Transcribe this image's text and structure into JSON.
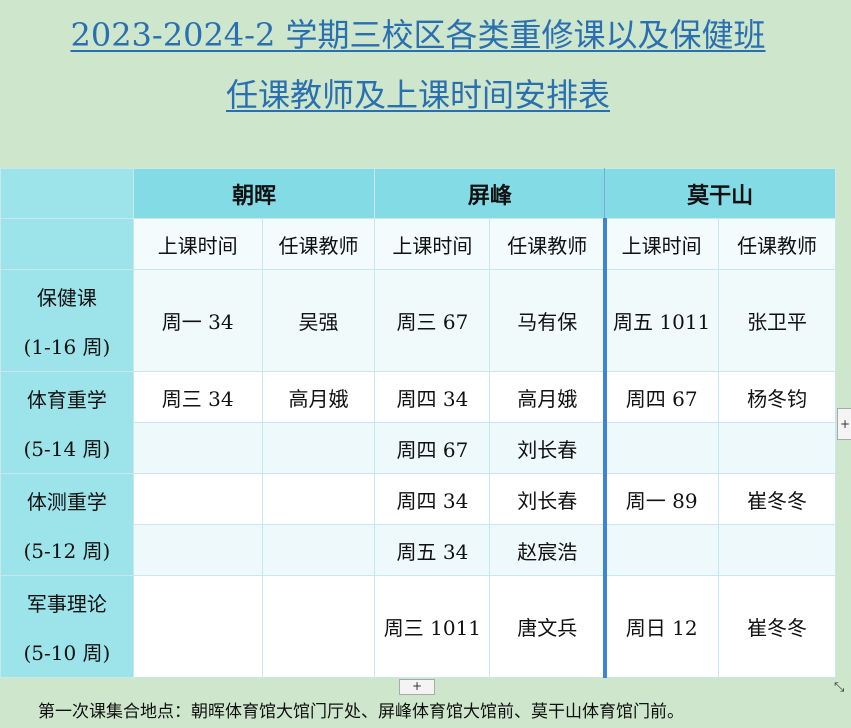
{
  "title": {
    "line1": "2023-2024-2 学期三校区各类重修课以及保健班",
    "line2": "任课教师及上课时间安排表"
  },
  "campuses": [
    "朝晖",
    "屏峰",
    "莫干山"
  ],
  "subheaders": [
    "上课时间",
    "任课教师",
    "上课时间",
    "任课教师",
    "上课时间",
    "任课教师"
  ],
  "courses": [
    {
      "name": "保健课",
      "weeks": "(1-16 周)"
    },
    {
      "name": "体育重学",
      "weeks": "(5-14 周)"
    },
    {
      "name": "体测重学",
      "weeks": "(5-12 周)"
    },
    {
      "name": "军事理论",
      "weeks": "(5-10 周)"
    }
  ],
  "cells": {
    "r1": [
      "周一 34",
      "吴强",
      "周三 67",
      "马有保",
      "周五 1011",
      "张卫平"
    ],
    "r2a": [
      "周三 34",
      "高月娥",
      "周四 34",
      "高月娥",
      "周四 67",
      "杨冬钧"
    ],
    "r2b": [
      "",
      "",
      "周四 67",
      "刘长春",
      "",
      ""
    ],
    "r3a": [
      "",
      "",
      "周四 34",
      "刘长春",
      "周一 89",
      "崔冬冬"
    ],
    "r3b": [
      "",
      "",
      "周五 34",
      "赵宸浩",
      "",
      ""
    ],
    "r4": [
      "",
      "",
      "周三 1011",
      "唐文兵",
      "周日 12",
      "崔冬冬"
    ]
  },
  "footer": "第一次课集合地点：朝晖体育馆大馆门厅处、屏峰体育馆大馆前、莫干山体育馆门前。",
  "controls": {
    "plus": "+",
    "resize": "⤡"
  }
}
